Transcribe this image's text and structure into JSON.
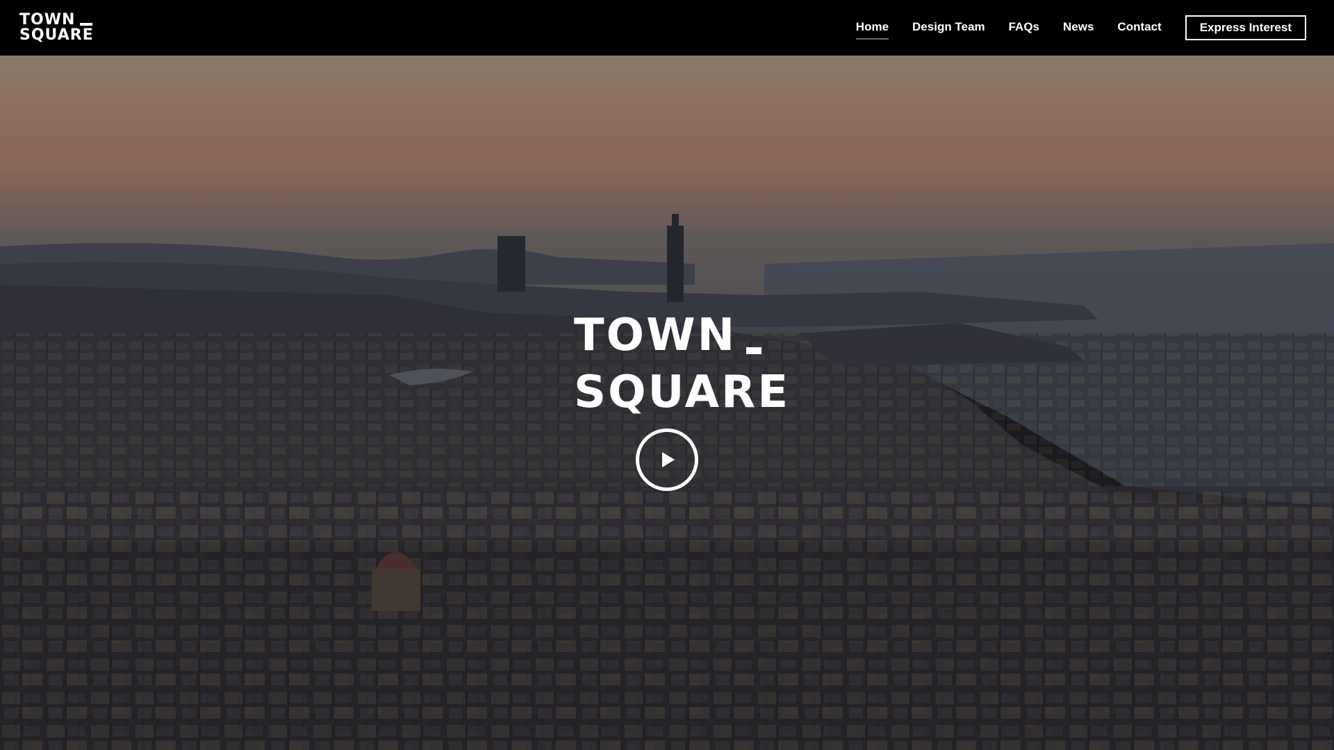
{
  "brand": {
    "line1": "TOWN",
    "line2": "SQUARE"
  },
  "nav": {
    "items": [
      {
        "label": "Home",
        "active": true
      },
      {
        "label": "Design Team",
        "active": false
      },
      {
        "label": "FAQs",
        "active": false
      },
      {
        "label": "News",
        "active": false
      },
      {
        "label": "Contact",
        "active": false
      }
    ],
    "cta_label": "Express Interest"
  },
  "hero": {
    "logo_line1": "TOWN",
    "logo_line2": "SQUARE",
    "play_icon": "play-icon",
    "background": "aerial-city-dusk-video"
  },
  "colors": {
    "header_bg": "#000000",
    "text": "#ffffff",
    "active_underline": "#6a6a6a"
  }
}
